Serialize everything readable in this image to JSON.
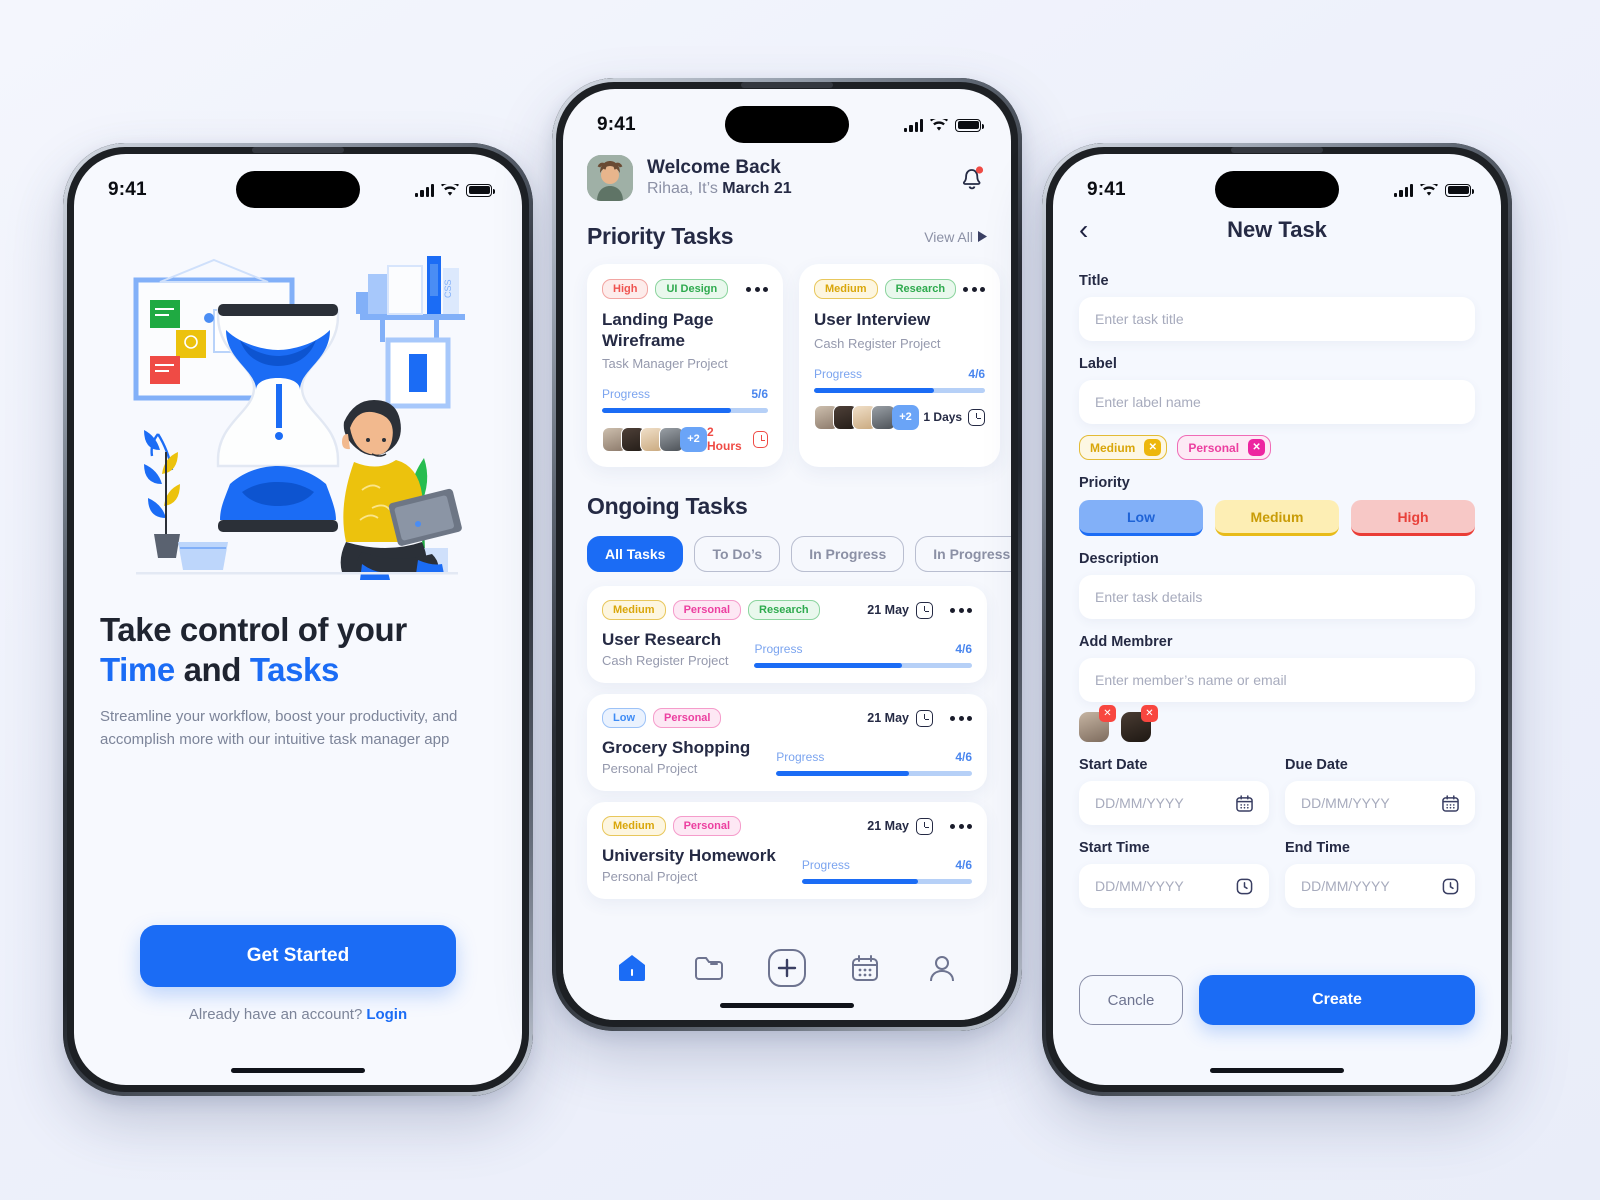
{
  "status_bar": {
    "time": "9:41",
    "signal_icon": "cellular-bars-icon",
    "wifi_icon": "wifi-icon",
    "battery_icon": "battery-icon"
  },
  "onboarding": {
    "illustration_name": "hourglass-person-laptop-illustration",
    "title_line1": "Take control of your",
    "title_time": "Time",
    "title_and": " and ",
    "title_tasks": "Tasks",
    "subtitle": "Streamline your workflow, boost your productivity, and accomplish more with our intuitive task manager app",
    "cta_label": "Get Started",
    "login_prompt": "Already have an account?",
    "login_label": "Login"
  },
  "home": {
    "greeting_title": "Welcome Back",
    "greeting_name": "Rihaa, It’s ",
    "greeting_date": "March 21",
    "bell_icon": "notification-bell-icon",
    "avatar_name": "user-avatar",
    "priority_section": {
      "title": "Priority Tasks",
      "view_all": "View All"
    },
    "priority_cards": [
      {
        "priority": "High",
        "category": "UI Design",
        "title": "Landing Page Wireframe",
        "project": "Task Manager Project",
        "progress_label": "Progress",
        "progress_value": "5/6",
        "progress_pct": 78,
        "extra_members": "+2",
        "due": "2 Hours",
        "due_style": "red"
      },
      {
        "priority": "Medium",
        "category": "Research",
        "title": "User Interview",
        "project": "Cash Register Project",
        "progress_label": "Progress",
        "progress_value": "4/6",
        "progress_pct": 70,
        "extra_members": "+2",
        "due": "1 Days",
        "due_style": "dark"
      }
    ],
    "ongoing_section": {
      "title": "Ongoing Tasks"
    },
    "filter_tabs": [
      {
        "label": "All Tasks",
        "active": true
      },
      {
        "label": "To Do’s",
        "active": false
      },
      {
        "label": "In Progress",
        "active": false
      },
      {
        "label": "In Progress",
        "active": false
      }
    ],
    "ongoing_tasks": [
      {
        "labels": [
          "Medium",
          "Personal",
          "Research"
        ],
        "date": "21 May",
        "title": "User Research",
        "project": "Cash Register Project",
        "progress_label": "Progress",
        "progress_value": "4/6",
        "progress_pct": 68
      },
      {
        "labels": [
          "Low",
          "Personal"
        ],
        "date": "21 May",
        "title": "Grocery Shopping",
        "project": "Personal Project",
        "progress_label": "Progress",
        "progress_value": "4/6",
        "progress_pct": 68
      },
      {
        "labels": [
          "Medium",
          "Personal"
        ],
        "date": "21 May",
        "title": "University Homework",
        "project": "Personal Project",
        "progress_label": "Progress",
        "progress_value": "4/6",
        "progress_pct": 68
      }
    ],
    "tabbar": [
      {
        "icon": "home-icon",
        "active": true
      },
      {
        "icon": "folder-icon",
        "active": false
      },
      {
        "icon": "plus-add-icon",
        "active": false
      },
      {
        "icon": "calendar-icon",
        "active": false
      },
      {
        "icon": "profile-person-icon",
        "active": false
      }
    ]
  },
  "new_task": {
    "back_icon": "chevron-left-icon",
    "title": "New Task",
    "title_label": "Title",
    "title_placeholder": "Enter task title",
    "label_label": "Label",
    "label_placeholder": "Enter label name",
    "label_chips": [
      {
        "text": "Medium",
        "remove_icon": "close-x-icon"
      },
      {
        "text": "Personal",
        "remove_icon": "close-x-icon"
      }
    ],
    "priority_label": "Priority",
    "priority_options": [
      "Low",
      "Medium",
      "High"
    ],
    "description_label": "Description",
    "description_placeholder": "Enter task details",
    "member_label": "Add Membrer",
    "member_placeholder": "Enter member’s name or email",
    "members": [
      {
        "name": "member-avatar-1",
        "remove_icon": "close-x-icon"
      },
      {
        "name": "member-avatar-2",
        "remove_icon": "close-x-icon"
      }
    ],
    "start_date_label": "Start Date",
    "due_date_label": "Due Date",
    "date_placeholder": "DD/MM/YYYY",
    "calendar_icon": "calendar-icon",
    "start_time_label": "Start Time",
    "end_time_label": "End Time",
    "time_placeholder": "DD/MM/YYYY",
    "clock_icon": "clock-icon",
    "cancel_label": "Cancle",
    "create_label": "Create"
  },
  "colors": {
    "primary": "#1b6cf5",
    "dark": "#252a44",
    "muted": "#8b90a5",
    "danger": "#ef4b45"
  }
}
